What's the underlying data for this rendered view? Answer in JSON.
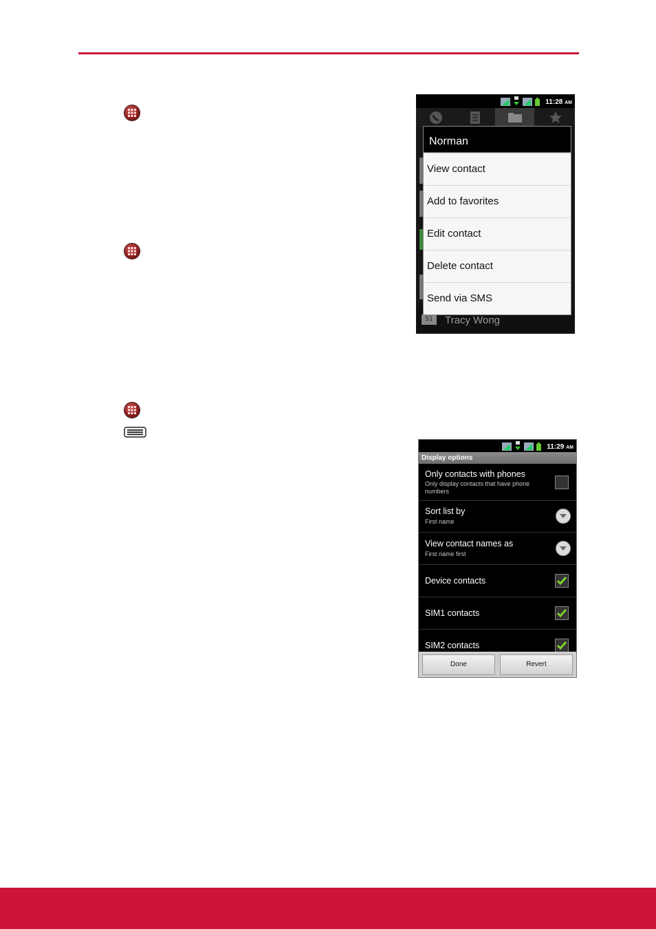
{
  "colors": {
    "accent": "#cc1439",
    "rule": "#c8173b",
    "check": "#7cd12a"
  },
  "phone1": {
    "status_time": "11:28",
    "status_ampm": "AM",
    "tabs": [
      "phone-icon",
      "call-log-icon",
      "contacts-icon",
      "favorites-icon"
    ],
    "selected_tab": 2,
    "menu": {
      "title": "Norman",
      "items": [
        "View contact",
        "Add to favorites",
        "Edit contact",
        "Delete contact",
        "Send via SMS"
      ]
    },
    "background_contact": {
      "badge": "S1",
      "name": "Tracy Wong"
    }
  },
  "phone2": {
    "status_time": "11:29",
    "status_ampm": "AM",
    "header": "Display options",
    "options": [
      {
        "title": "Only contacts with phones",
        "subtitle": "Only display contacts that have phone numbers",
        "control": "checkbox",
        "checked": false
      },
      {
        "title": "Sort list by",
        "subtitle": "First name",
        "control": "dropdown"
      },
      {
        "title": "View contact names as",
        "subtitle": "First name first",
        "control": "dropdown"
      },
      {
        "title": "Device contacts",
        "subtitle": "",
        "control": "checkbox",
        "checked": true
      },
      {
        "title": "SIM1 contacts",
        "subtitle": "",
        "control": "checkbox",
        "checked": true
      },
      {
        "title": "SIM2 contacts",
        "subtitle": "",
        "control": "checkbox",
        "checked": true
      }
    ],
    "buttons": {
      "done": "Done",
      "revert": "Revert"
    }
  }
}
